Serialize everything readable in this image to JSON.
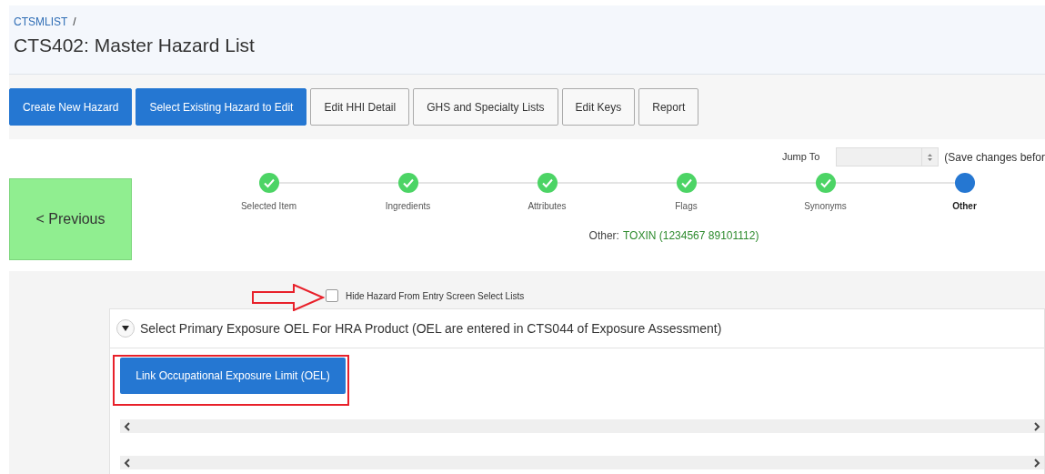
{
  "breadcrumb": {
    "link": "CTSMLIST",
    "separator": "/"
  },
  "title": "CTS402: Master Hazard List",
  "toolbar": [
    {
      "label": "Create New Hazard",
      "kind": "primary"
    },
    {
      "label": "Select Existing Hazard to Edit",
      "kind": "primary"
    },
    {
      "label": "Edit HHI Detail",
      "kind": "secondary"
    },
    {
      "label": "GHS and Specialty Lists",
      "kind": "secondary"
    },
    {
      "label": "Edit Keys",
      "kind": "secondary"
    },
    {
      "label": "Report",
      "kind": "secondary"
    }
  ],
  "previous_button": "< Previous",
  "jump_to": {
    "label": "Jump To",
    "note": "(Save changes befor"
  },
  "steps": [
    {
      "label": "Selected Item",
      "completed": true,
      "selected": false
    },
    {
      "label": "Ingredients",
      "completed": true,
      "selected": false
    },
    {
      "label": "Attributes",
      "completed": true,
      "selected": false
    },
    {
      "label": "Flags",
      "completed": true,
      "selected": false
    },
    {
      "label": "Synonyms",
      "completed": true,
      "selected": false
    },
    {
      "label": "Other",
      "completed": false,
      "selected": true
    }
  ],
  "current_item": {
    "label": "Other:",
    "value": "TOXIN (1234567 89101112)"
  },
  "hide_checkbox": {
    "label": "Hide Hazard From Entry Screen Select Lists",
    "checked": false
  },
  "region": {
    "title": "Select Primary Exposure OEL For HRA Product (OEL are entered in CTS044 of Exposure Assessment)",
    "expanded": true,
    "button": "Link Occupational Exposure Limit (OEL)"
  }
}
